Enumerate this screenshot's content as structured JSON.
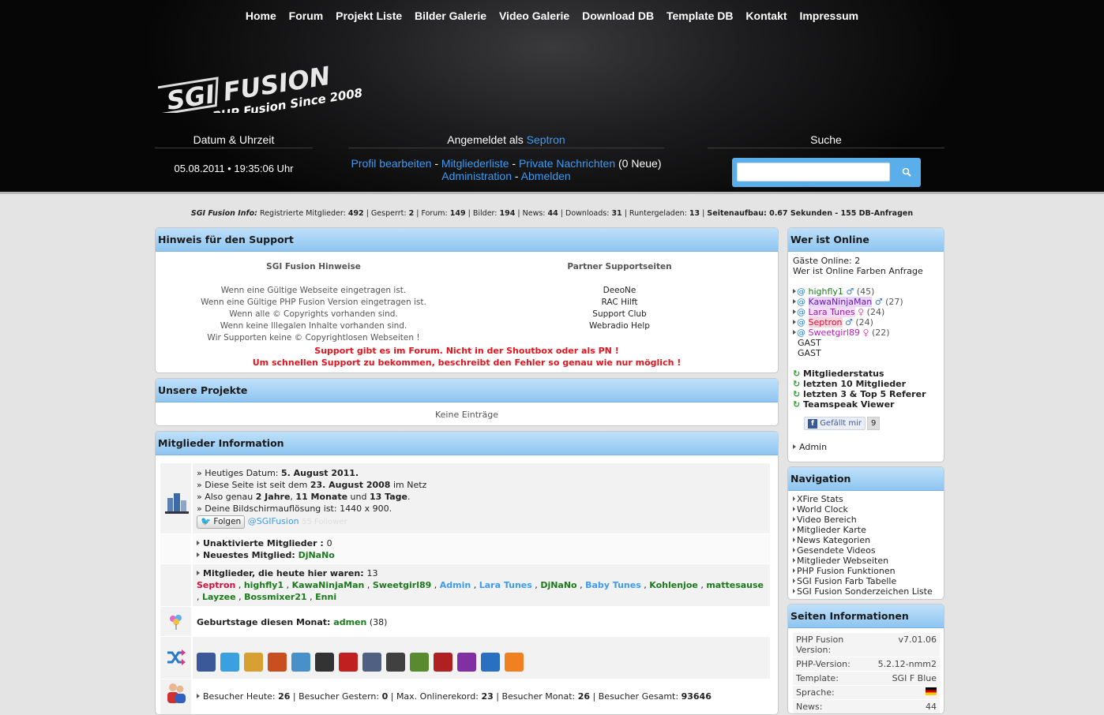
{
  "nav": [
    "Home",
    "Forum",
    "Projekt Liste",
    "Bilder Galerie",
    "Video Galerie",
    "Download DB",
    "Template DB",
    "Kontakt",
    "Impressum"
  ],
  "logo": {
    "title": "SGI FUSION",
    "tagline": "PHP Fusion Since 2008"
  },
  "datetime": {
    "title": "Datum & Uhrzeit",
    "value": "05.08.2011 • 19:35:06 Uhr"
  },
  "login": {
    "title_prefix": "Angemeldet als ",
    "user": "Septron",
    "links": [
      "Profil bearbeiten",
      "Mitgliederliste",
      "Private Nachrichten",
      "Administration",
      "Abmelden"
    ],
    "sep": " - ",
    "new_msgs": " (0 Neue)"
  },
  "search": {
    "title": "Suche",
    "placeholder": ""
  },
  "info": {
    "label": "SGI Fusion Info:",
    "registered_label": "Registrierte Mitglieder:",
    "registered": "492",
    "banned_label": "Gesperrt:",
    "banned": "2",
    "forum_label": "Forum:",
    "forum": "149",
    "images_label": "Bilder:",
    "images": "194",
    "news_label": "News:",
    "news": "44",
    "downloads_label": "Downloads:",
    "downloads": "31",
    "dl_label": "Runtergeladen:",
    "dl": "13",
    "render": "Seitenaufbau: 0.67 Sekunden - 155 DB-Anfragen"
  },
  "support": {
    "title": "Hinweis für den Support",
    "left_title": "SGI Fusion Hinweise",
    "left": [
      "Wenn eine Gültige Webseite eingetragen ist.",
      "Wenn eine Gültige PHP Fusion Version eingetragen ist.",
      "Wenn alle © Copyrights vorhanden sind.",
      "Wenn keine Illegalen Inhalte vorhanden sind.",
      "Wir Supporten keine © Copyrightlosen Webseiten !"
    ],
    "right_title": "Partner Supportseiten",
    "right": [
      "DeeoNe",
      "RAC Hilft",
      "Support Club",
      "Webradio Help"
    ],
    "warn1": "Support gibt es im Forum. Nicht in der Shoutbox oder als PN !",
    "warn2": "Um schnellen Support zu bekommen, beschreibt den Fehler so genau wie nur möglich !"
  },
  "projects": {
    "title": "Unsere Projekte",
    "empty": "Keine Einträge"
  },
  "members": {
    "title": "Mitglieder Information",
    "today_label": "» Heutiges Datum: ",
    "today": "5. August 2011.",
    "since_a": "» Diese Seite ist seit dem ",
    "since": "23. August 2008",
    "since_b": " im Netz",
    "approx_a": "» Also genau ",
    "years": "2 Jahre",
    "comma": ", ",
    "months": "11 Monate",
    "and": " und ",
    "days": "13 Tage",
    "dot": ".",
    "res": "» Deine Bildschirmauflösung ist: 1440 x 900.",
    "follow": "Folgen",
    "handle": "@SGIFusion",
    "followers": "55 Follower",
    "inactive_label": "Unaktivierte Mitglieder : ",
    "inactive": "0",
    "newest_label": "Neuestes Mitglied: ",
    "newest": "DjNaNo",
    "today_members_label": "Mitglieder, die heute hier waren: ",
    "today_members_count": "13",
    "today_members": [
      {
        "n": "Septron",
        "c": "#d01042"
      },
      {
        "n": "highfly1",
        "c": "#1b7a1b"
      },
      {
        "n": "KawaNinjaMan",
        "c": "#1b7a1b"
      },
      {
        "n": "Sweetgirl89",
        "c": "#1b7a1b"
      },
      {
        "n": "Admin",
        "c": "#3d9bf3"
      },
      {
        "n": "Lara Tunes",
        "c": "#3d9bf3"
      },
      {
        "n": "DjNaNo",
        "c": "#1b7a1b"
      },
      {
        "n": "Baby Tunes",
        "c": "#3d9bf3"
      },
      {
        "n": "Kohlenjoe",
        "c": "#1b7a1b"
      },
      {
        "n": "mattesause",
        "c": "#1b7a1b"
      },
      {
        "n": "Layzee",
        "c": "#1b7a1b"
      },
      {
        "n": "Bossmixer21",
        "c": "#1b7a1b"
      },
      {
        "n": "Enni",
        "c": "#1b7a1b"
      }
    ],
    "bday_label": "Geburtstage diesen Monat: ",
    "bday_user": "admen",
    "bday_age": " (38)",
    "visitors": [
      {
        "l": "Besucher Heute: ",
        "v": "26"
      },
      {
        "l": "Besucher Gestern: ",
        "v": "0"
      },
      {
        "l": "Max. Onlinerekord: ",
        "v": "23"
      },
      {
        "l": "Besucher Monat: ",
        "v": "26"
      },
      {
        "l": "Besucher Gesamt: ",
        "v": "93646"
      }
    ]
  },
  "social_icons": [
    "facebook-icon",
    "twitter-icon",
    "steam-like-icon",
    "gear-icon",
    "molecule-icon",
    "xfire-icon",
    "youtube-icon",
    "stripes-icon",
    "game-icon",
    "chart-icon",
    "red-game-icon",
    "purple-game-icon",
    "ie-icon",
    "rss-icon"
  ],
  "online": {
    "title": "Wer ist Online",
    "guests": "Gäste Online: 2",
    "colors_a": "Wer ist Online Farben ",
    "colors_b": "Anfrage",
    "users": [
      {
        "n": "highfly1",
        "c": "#1b7a1b",
        "sym": "♂",
        "age": "(45)"
      },
      {
        "n": "KawaNinjaMan",
        "c": "#6a1bb0",
        "sym": "♂",
        "age": "(27)",
        "hl": "#e8d5f7"
      },
      {
        "n": "Lara Tunes",
        "c": "#9b1bb0",
        "sym": "♀",
        "age": "(24)",
        "hl": "#f5dcf5"
      },
      {
        "n": "Septron",
        "c": "#d01042",
        "sym": "♂",
        "age": "(24)",
        "hl": "#f9d6dc"
      },
      {
        "n": "Sweetgirl89",
        "c": "#c218c2",
        "sym": "♀",
        "age": "(22)"
      }
    ],
    "gast": [
      "GAST",
      "GAST"
    ],
    "links": [
      "Mitgliederstatus",
      "letzten 10 Mitglieder",
      "letzten 3 & Top 5 Referer",
      "Teamspeak Viewer"
    ],
    "like": "Gefällt mir",
    "likes": "9",
    "admin": "Admin"
  },
  "navigation": {
    "title": "Navigation",
    "items": [
      "XFire Stats",
      "World Clock",
      "Video Bereich",
      "Mitglieder Karte",
      "News Kategorien",
      "Gesendete Videos",
      "Mitglieder Webseiten",
      "PHP Fusion Funktionen",
      "SGI Fusion Farb Tabelle",
      "SGI Fusion Sonderzeichen Liste"
    ]
  },
  "site_info": {
    "title": "Seiten Informationen",
    "rows": [
      {
        "k": "PHP Fusion Version:",
        "v": "v7.01.06"
      },
      {
        "k": "PHP-Version:",
        "v": "5.2.12-nmm2"
      },
      {
        "k": "Template:",
        "v": "SGI F Blue"
      },
      {
        "k": "Sprache:",
        "v": ""
      },
      {
        "k": "News:",
        "v": "44"
      }
    ]
  },
  "colors": {
    "accent": "#3d9bf3",
    "panel_header": "#a8d3f5",
    "warn": "#e3141d"
  }
}
